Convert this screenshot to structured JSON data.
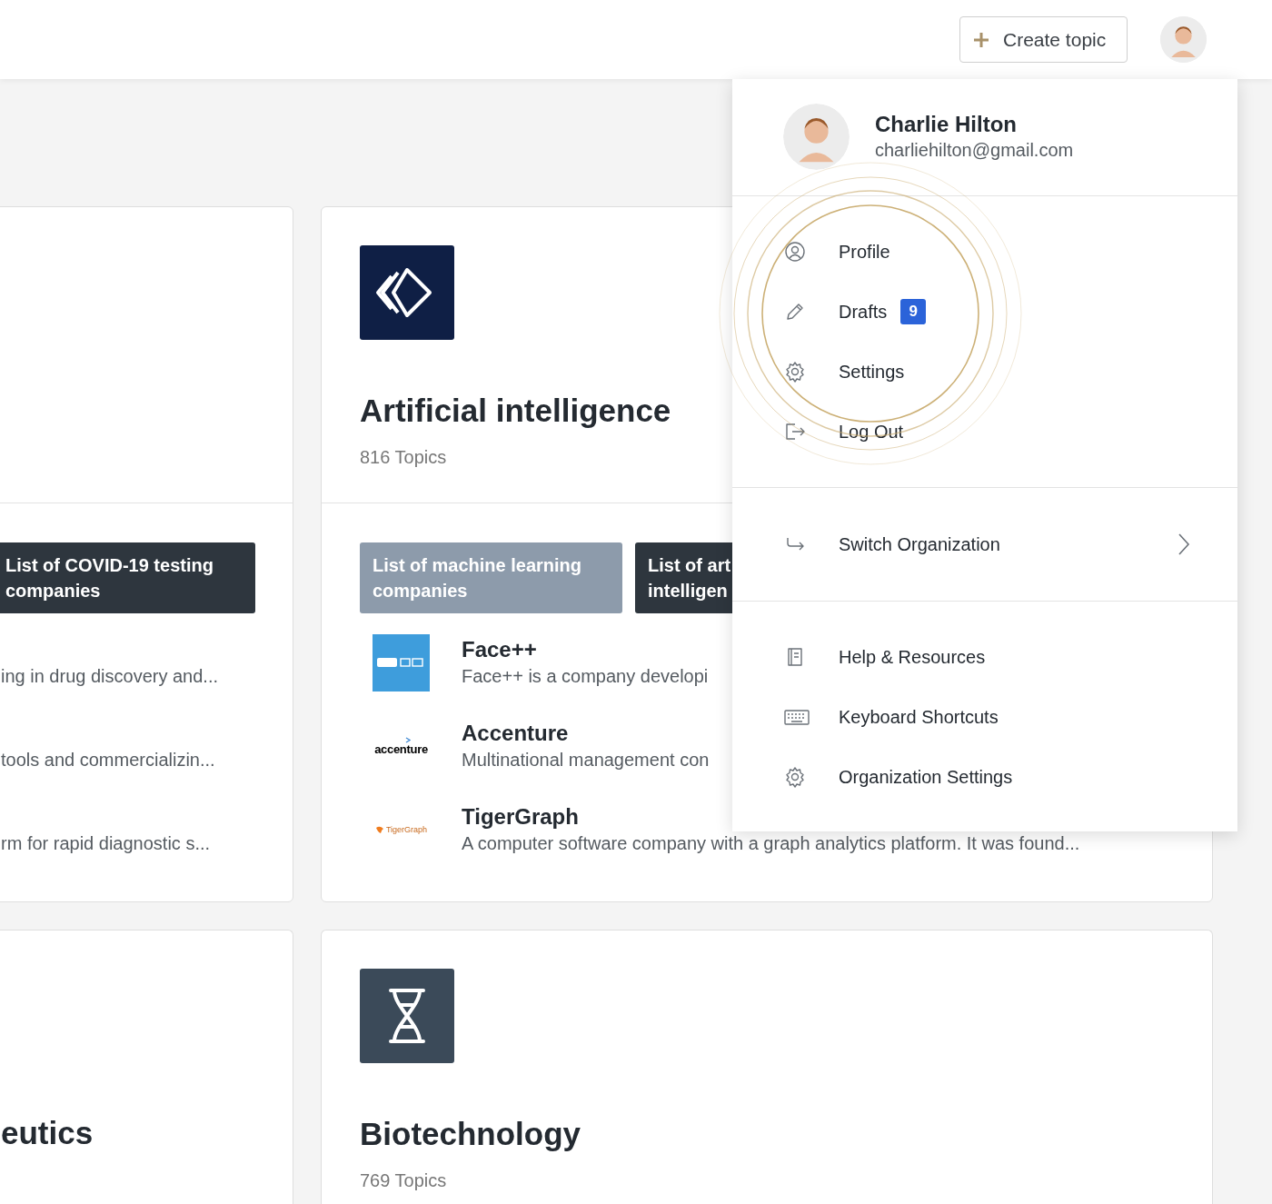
{
  "header": {
    "create_button": {
      "label": "Create topic"
    }
  },
  "cards_row1": [
    {
      "kind": "cut",
      "tags": [
        {
          "label": "List of COVID-19 testing companies",
          "dark": true
        }
      ],
      "entries": [
        {
          "description": "ing in drug discovery and..."
        },
        {
          "description": "tools and commercializin..."
        },
        {
          "description": "rm for rapid diagnostic s..."
        }
      ]
    },
    {
      "kind": "ai",
      "title": "Artificial intelligence",
      "subtitle": "816 Topics",
      "tags": [
        {
          "label": "List of machine learning companies",
          "dark": false
        },
        {
          "label": "List of art intelligen",
          "dark": true
        }
      ],
      "entries": [
        {
          "kind": "faceplus",
          "name": "Face++",
          "description": "Face++ is a company developi"
        },
        {
          "kind": "accenture",
          "logo_text": "accenture",
          "name": "Accenture",
          "description": "Multinational management con"
        },
        {
          "kind": "tigergraph",
          "logo_text": "TigerGraph",
          "name": "TigerGraph",
          "description": "A computer software company with a graph analytics platform. It was found..."
        }
      ]
    }
  ],
  "cards_row2": [
    {
      "kind": "cut",
      "title": "eutics"
    },
    {
      "kind": "dna",
      "title": "Biotechnology",
      "subtitle": "769 Topics"
    }
  ],
  "user_menu": {
    "name": "Charlie Hilton",
    "email": "charliehilton@gmail.com",
    "sections": [
      [
        {
          "kind": "user",
          "label": "Profile"
        },
        {
          "kind": "pencil",
          "label": "Drafts",
          "badge": "9"
        },
        {
          "kind": "gear",
          "label": "Settings"
        },
        {
          "kind": "logout",
          "label": "Log Out"
        }
      ],
      [
        {
          "kind": "switch",
          "label": "Switch Organization",
          "submenu": true
        }
      ],
      [
        {
          "kind": "book",
          "label": "Help & Resources"
        },
        {
          "kind": "keyboard",
          "label": "Keyboard Shortcuts"
        },
        {
          "kind": "gear",
          "label": "Organization Settings"
        }
      ]
    ]
  }
}
